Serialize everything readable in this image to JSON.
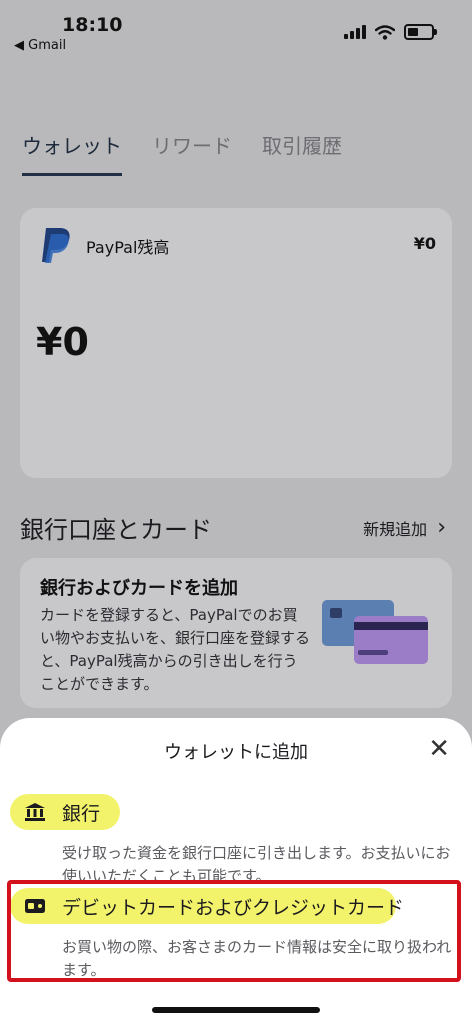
{
  "status_bar": {
    "time": "18:10",
    "back_app": "◀ Gmail"
  },
  "tabs": [
    {
      "label": "ウォレット",
      "active": true
    },
    {
      "label": "リワード",
      "active": false
    },
    {
      "label": "取引履歴",
      "active": false
    }
  ],
  "balance_card": {
    "name": "PayPal残高",
    "amount_small": "¥0",
    "amount_big": "¥0"
  },
  "bank_section": {
    "title": "銀行口座とカード",
    "add_new": "新規追加"
  },
  "promo": {
    "title": "銀行およびカードを追加",
    "description": "カードを登録すると、PayPalでのお買い物やお支払いを、銀行口座を登録すると、PayPal残高からの引き出しを行うことができます。"
  },
  "sheet": {
    "title": "ウォレットに追加",
    "options": [
      {
        "icon": "bank-icon",
        "label": "銀行",
        "description": "受け取った資金を銀行口座に引き出します。お支払いにお使いいただくことも可能です。"
      },
      {
        "icon": "card-icon",
        "label": "デビットカードおよびクレジットカード",
        "description": "お買い物の際、お客さまのカード情報は安全に取り扱われます。"
      }
    ]
  },
  "colors": {
    "highlight": "#f3f36b",
    "annotation_box": "#d3111d",
    "tab_underline": "#223047"
  }
}
